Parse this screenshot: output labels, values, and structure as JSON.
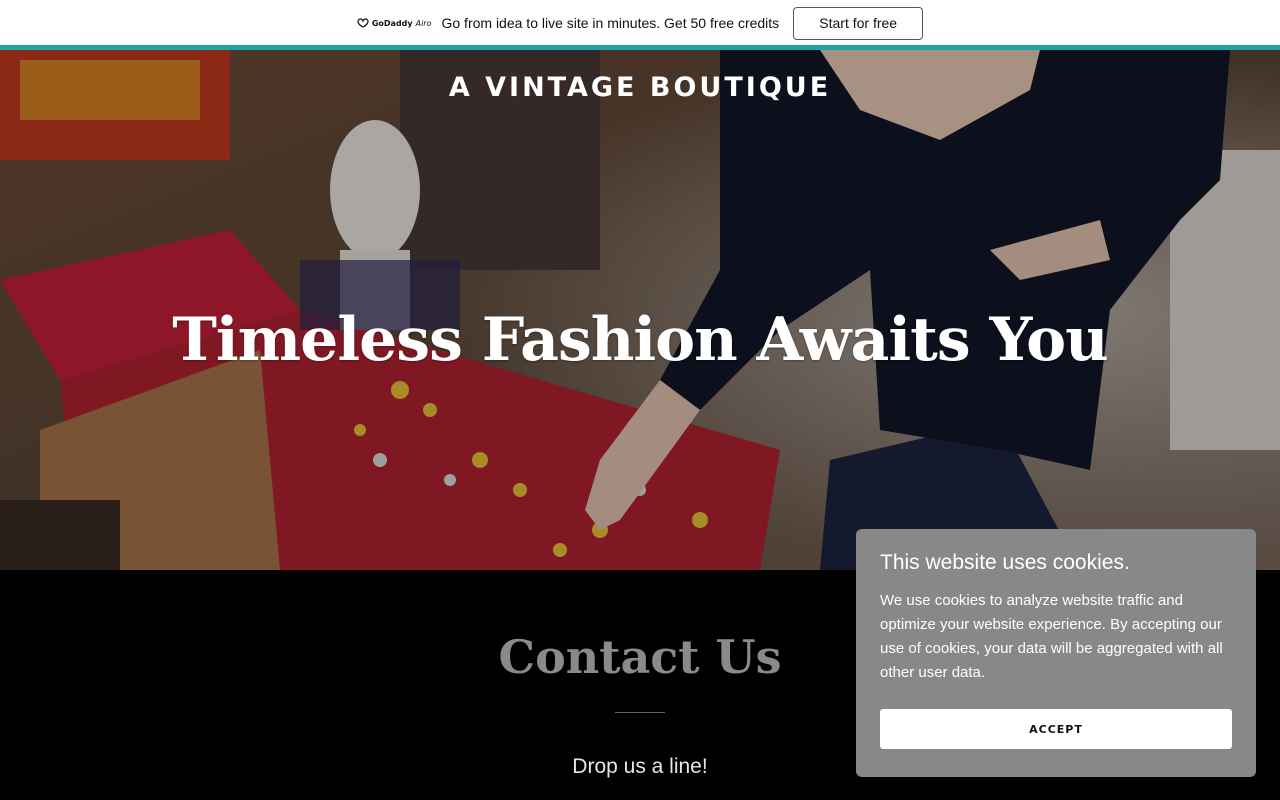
{
  "promo": {
    "logo_brand": "GoDaddy",
    "logo_product": "Airo",
    "message": "Go from idea to live site in minutes. Get 50 free credits",
    "button_label": "Start for free",
    "accent_color": "#1fa3a3"
  },
  "hero": {
    "site_title": "A VINTAGE BOUTIQUE",
    "headline": "Timeless Fashion Awaits You"
  },
  "contact": {
    "title": "Contact Us",
    "subtitle": "Drop us a line!"
  },
  "cookie_banner": {
    "title": "This website uses cookies.",
    "body": "We use cookies to analyze website traffic and optimize your website experience. By accepting our use of cookies, your data will be aggregated with all other user data.",
    "accept_label": "ACCEPT"
  }
}
